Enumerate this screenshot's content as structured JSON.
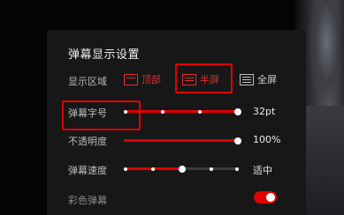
{
  "panel": {
    "title": "弹幕显示设置"
  },
  "display_area": {
    "label": "显示区域",
    "options": [
      {
        "label": "顶部",
        "state": "selected",
        "icon": "top-area-icon"
      },
      {
        "label": "半屏",
        "state": "highlighted",
        "icon": "half-screen-icon"
      },
      {
        "label": "全屏",
        "state": "normal",
        "icon": "full-screen-icon"
      }
    ]
  },
  "font_size": {
    "label": "弹幕字号",
    "value_text": "32pt",
    "level": 1.0,
    "steps": 5
  },
  "opacity": {
    "label": "不透明度",
    "value_text": "100%",
    "level": 1.0
  },
  "speed": {
    "label": "弹幕速度",
    "value_text": "适中",
    "level": 0.5,
    "steps": 5
  },
  "color_danmaku": {
    "label": "彩色弹幕",
    "enabled": true
  },
  "colors": {
    "accent": "#e00000",
    "panel_bg": "#171717",
    "track": "#3b3b3b"
  }
}
